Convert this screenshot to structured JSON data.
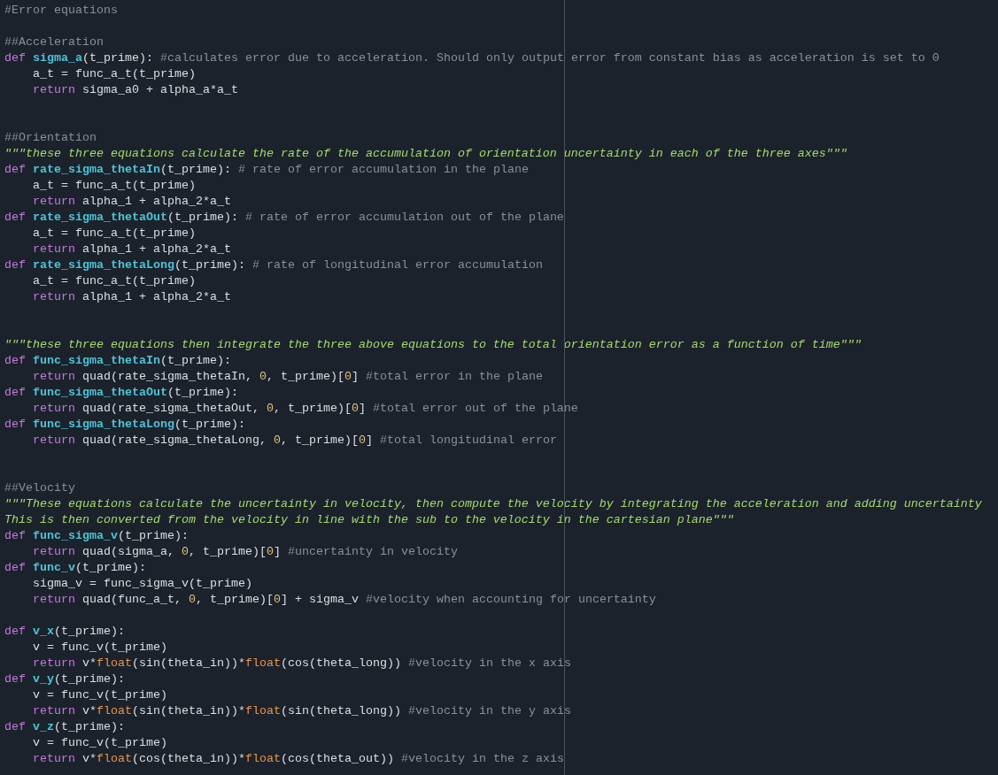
{
  "editor": {
    "lines": [
      {
        "kind": "code",
        "indented": false,
        "tokens": [
          {
            "kind": "comment",
            "text": "#Error equations"
          }
        ]
      },
      {
        "kind": "blank"
      },
      {
        "kind": "code",
        "indented": false,
        "tokens": [
          {
            "kind": "comment",
            "text": "##Acceleration"
          }
        ]
      },
      {
        "kind": "code",
        "indented": false,
        "tokens": [
          {
            "kind": "keyword",
            "text": "def "
          },
          {
            "kind": "function",
            "text": "sigma_a"
          },
          {
            "kind": "plain",
            "text": "(t_prime): "
          },
          {
            "kind": "comment",
            "text": "#calculates error due to acceleration. Should only output error from constant bias as acceleration is set to 0"
          }
        ]
      },
      {
        "kind": "code",
        "indented": true,
        "tokens": [
          {
            "kind": "plain",
            "text": "a_t = func_a_t(t_prime)"
          }
        ]
      },
      {
        "kind": "code",
        "indented": true,
        "tokens": [
          {
            "kind": "keyword",
            "text": "return "
          },
          {
            "kind": "plain",
            "text": "sigma_a0 + alpha_a*a_t"
          }
        ]
      },
      {
        "kind": "blank"
      },
      {
        "kind": "blank"
      },
      {
        "kind": "code",
        "indented": false,
        "tokens": [
          {
            "kind": "comment",
            "text": "##Orientation"
          }
        ]
      },
      {
        "kind": "code",
        "indented": false,
        "tokens": [
          {
            "kind": "docstring",
            "text": "\"\"\"these three equations calculate the rate of the accumulation of orientation uncertainty in each of the three axes\"\"\""
          }
        ]
      },
      {
        "kind": "code",
        "indented": false,
        "tokens": [
          {
            "kind": "keyword",
            "text": "def "
          },
          {
            "kind": "function",
            "text": "rate_sigma_thetaIn"
          },
          {
            "kind": "plain",
            "text": "(t_prime): "
          },
          {
            "kind": "comment",
            "text": "# rate of error accumulation in the plane"
          }
        ]
      },
      {
        "kind": "code",
        "indented": true,
        "tokens": [
          {
            "kind": "plain",
            "text": "a_t = func_a_t(t_prime)"
          }
        ]
      },
      {
        "kind": "code",
        "indented": true,
        "tokens": [
          {
            "kind": "keyword",
            "text": "return "
          },
          {
            "kind": "plain",
            "text": "alpha_1 + alpha_2*a_t"
          }
        ]
      },
      {
        "kind": "code",
        "indented": false,
        "tokens": [
          {
            "kind": "keyword",
            "text": "def "
          },
          {
            "kind": "function",
            "text": "rate_sigma_thetaOut"
          },
          {
            "kind": "plain",
            "text": "(t_prime): "
          },
          {
            "kind": "comment",
            "text": "# rate of error accumulation out of the plane"
          }
        ]
      },
      {
        "kind": "code",
        "indented": true,
        "tokens": [
          {
            "kind": "plain",
            "text": "a_t = func_a_t(t_prime)"
          }
        ]
      },
      {
        "kind": "code",
        "indented": true,
        "tokens": [
          {
            "kind": "keyword",
            "text": "return "
          },
          {
            "kind": "plain",
            "text": "alpha_1 + alpha_2*a_t"
          }
        ]
      },
      {
        "kind": "code",
        "indented": false,
        "tokens": [
          {
            "kind": "keyword",
            "text": "def "
          },
          {
            "kind": "function",
            "text": "rate_sigma_thetaLong"
          },
          {
            "kind": "plain",
            "text": "(t_prime): "
          },
          {
            "kind": "comment",
            "text": "# rate of longitudinal error accumulation"
          }
        ]
      },
      {
        "kind": "code",
        "indented": true,
        "tokens": [
          {
            "kind": "plain",
            "text": "a_t = func_a_t(t_prime)"
          }
        ]
      },
      {
        "kind": "code",
        "indented": true,
        "tokens": [
          {
            "kind": "keyword",
            "text": "return "
          },
          {
            "kind": "plain",
            "text": "alpha_1 + alpha_2*a_t"
          }
        ]
      },
      {
        "kind": "blank"
      },
      {
        "kind": "blank"
      },
      {
        "kind": "code",
        "indented": false,
        "tokens": [
          {
            "kind": "docstring",
            "text": "\"\"\"these three equations then integrate the three above equations to the total orientation error as a function of time\"\"\""
          }
        ]
      },
      {
        "kind": "code",
        "indented": false,
        "tokens": [
          {
            "kind": "keyword",
            "text": "def "
          },
          {
            "kind": "function",
            "text": "func_sigma_thetaIn"
          },
          {
            "kind": "plain",
            "text": "(t_prime):"
          }
        ]
      },
      {
        "kind": "code",
        "indented": true,
        "tokens": [
          {
            "kind": "keyword",
            "text": "return "
          },
          {
            "kind": "plain",
            "text": "quad(rate_sigma_thetaIn, "
          },
          {
            "kind": "number",
            "text": "0"
          },
          {
            "kind": "plain",
            "text": ", t_prime)["
          },
          {
            "kind": "number",
            "text": "0"
          },
          {
            "kind": "plain",
            "text": "] "
          },
          {
            "kind": "comment",
            "text": "#total error in the plane"
          }
        ]
      },
      {
        "kind": "code",
        "indented": false,
        "tokens": [
          {
            "kind": "keyword",
            "text": "def "
          },
          {
            "kind": "function",
            "text": "func_sigma_thetaOut"
          },
          {
            "kind": "plain",
            "text": "(t_prime):"
          }
        ]
      },
      {
        "kind": "code",
        "indented": true,
        "tokens": [
          {
            "kind": "keyword",
            "text": "return "
          },
          {
            "kind": "plain",
            "text": "quad(rate_sigma_thetaOut, "
          },
          {
            "kind": "number",
            "text": "0"
          },
          {
            "kind": "plain",
            "text": ", t_prime)["
          },
          {
            "kind": "number",
            "text": "0"
          },
          {
            "kind": "plain",
            "text": "] "
          },
          {
            "kind": "comment",
            "text": "#total error out of the plane"
          }
        ]
      },
      {
        "kind": "code",
        "indented": false,
        "tokens": [
          {
            "kind": "keyword",
            "text": "def "
          },
          {
            "kind": "function",
            "text": "func_sigma_thetaLong"
          },
          {
            "kind": "plain",
            "text": "(t_prime):"
          }
        ]
      },
      {
        "kind": "code",
        "indented": true,
        "tokens": [
          {
            "kind": "keyword",
            "text": "return "
          },
          {
            "kind": "plain",
            "text": "quad(rate_sigma_thetaLong, "
          },
          {
            "kind": "number",
            "text": "0"
          },
          {
            "kind": "plain",
            "text": ", t_prime)["
          },
          {
            "kind": "number",
            "text": "0"
          },
          {
            "kind": "plain",
            "text": "] "
          },
          {
            "kind": "comment",
            "text": "#total longitudinal error"
          }
        ]
      },
      {
        "kind": "blank"
      },
      {
        "kind": "blank"
      },
      {
        "kind": "code",
        "indented": false,
        "tokens": [
          {
            "kind": "comment",
            "text": "##Velocity"
          }
        ]
      },
      {
        "kind": "code",
        "indented": false,
        "tokens": [
          {
            "kind": "docstring",
            "text": "\"\"\"These equations calculate the uncertainty in velocity, then compute the velocity by integrating the acceleration and adding uncertainty"
          }
        ]
      },
      {
        "kind": "code",
        "indented": false,
        "tokens": [
          {
            "kind": "docstring",
            "text": "This is then converted from the velocity in line with the sub to the velocity in the cartesian plane\"\"\""
          }
        ]
      },
      {
        "kind": "code",
        "indented": false,
        "tokens": [
          {
            "kind": "keyword",
            "text": "def "
          },
          {
            "kind": "function",
            "text": "func_sigma_v"
          },
          {
            "kind": "plain",
            "text": "(t_prime):"
          }
        ]
      },
      {
        "kind": "code",
        "indented": true,
        "tokens": [
          {
            "kind": "keyword",
            "text": "return "
          },
          {
            "kind": "plain",
            "text": "quad(sigma_a, "
          },
          {
            "kind": "number",
            "text": "0"
          },
          {
            "kind": "plain",
            "text": ", t_prime)["
          },
          {
            "kind": "number",
            "text": "0"
          },
          {
            "kind": "plain",
            "text": "] "
          },
          {
            "kind": "comment",
            "text": "#uncertainty in velocity"
          }
        ]
      },
      {
        "kind": "code",
        "indented": false,
        "tokens": [
          {
            "kind": "keyword",
            "text": "def "
          },
          {
            "kind": "function",
            "text": "func_v"
          },
          {
            "kind": "plain",
            "text": "(t_prime):"
          }
        ]
      },
      {
        "kind": "code",
        "indented": true,
        "tokens": [
          {
            "kind": "plain",
            "text": "sigma_v = func_sigma_v(t_prime)"
          }
        ]
      },
      {
        "kind": "code",
        "indented": true,
        "tokens": [
          {
            "kind": "keyword",
            "text": "return "
          },
          {
            "kind": "plain",
            "text": "quad(func_a_t, "
          },
          {
            "kind": "number",
            "text": "0"
          },
          {
            "kind": "plain",
            "text": ", t_prime)["
          },
          {
            "kind": "number",
            "text": "0"
          },
          {
            "kind": "plain",
            "text": "] + sigma_v "
          },
          {
            "kind": "comment",
            "text": "#velocity when accounting for uncertainty"
          }
        ]
      },
      {
        "kind": "blank"
      },
      {
        "kind": "code",
        "indented": false,
        "tokens": [
          {
            "kind": "keyword",
            "text": "def "
          },
          {
            "kind": "function",
            "text": "v_x"
          },
          {
            "kind": "plain",
            "text": "(t_prime):"
          }
        ]
      },
      {
        "kind": "code",
        "indented": true,
        "tokens": [
          {
            "kind": "plain",
            "text": "v = func_v(t_prime)"
          }
        ]
      },
      {
        "kind": "code",
        "indented": true,
        "tokens": [
          {
            "kind": "keyword",
            "text": "return "
          },
          {
            "kind": "plain",
            "text": "v*"
          },
          {
            "kind": "builtin",
            "text": "float"
          },
          {
            "kind": "plain",
            "text": "(sin(theta_in))*"
          },
          {
            "kind": "builtin",
            "text": "float"
          },
          {
            "kind": "plain",
            "text": "(cos(theta_long)) "
          },
          {
            "kind": "comment",
            "text": "#velocity in the x axis"
          }
        ]
      },
      {
        "kind": "code",
        "indented": false,
        "tokens": [
          {
            "kind": "keyword",
            "text": "def "
          },
          {
            "kind": "function",
            "text": "v_y"
          },
          {
            "kind": "plain",
            "text": "(t_prime):"
          }
        ]
      },
      {
        "kind": "code",
        "indented": true,
        "tokens": [
          {
            "kind": "plain",
            "text": "v = func_v(t_prime)"
          }
        ]
      },
      {
        "kind": "code",
        "indented": true,
        "tokens": [
          {
            "kind": "keyword",
            "text": "return "
          },
          {
            "kind": "plain",
            "text": "v*"
          },
          {
            "kind": "builtin",
            "text": "float"
          },
          {
            "kind": "plain",
            "text": "(sin(theta_in))*"
          },
          {
            "kind": "builtin",
            "text": "float"
          },
          {
            "kind": "plain",
            "text": "(sin(theta_long)) "
          },
          {
            "kind": "comment",
            "text": "#velocity in the y axis"
          }
        ]
      },
      {
        "kind": "code",
        "indented": false,
        "tokens": [
          {
            "kind": "keyword",
            "text": "def "
          },
          {
            "kind": "function",
            "text": "v_z"
          },
          {
            "kind": "plain",
            "text": "(t_prime):"
          }
        ]
      },
      {
        "kind": "code",
        "indented": true,
        "tokens": [
          {
            "kind": "plain",
            "text": "v = func_v(t_prime)"
          }
        ]
      },
      {
        "kind": "code",
        "indented": true,
        "tokens": [
          {
            "kind": "keyword",
            "text": "return "
          },
          {
            "kind": "plain",
            "text": "v*"
          },
          {
            "kind": "builtin",
            "text": "float"
          },
          {
            "kind": "plain",
            "text": "(cos(theta_in))*"
          },
          {
            "kind": "builtin",
            "text": "float"
          },
          {
            "kind": "plain",
            "text": "(cos(theta_out)) "
          },
          {
            "kind": "comment",
            "text": "#velocity in the z axis"
          }
        ]
      }
    ]
  }
}
